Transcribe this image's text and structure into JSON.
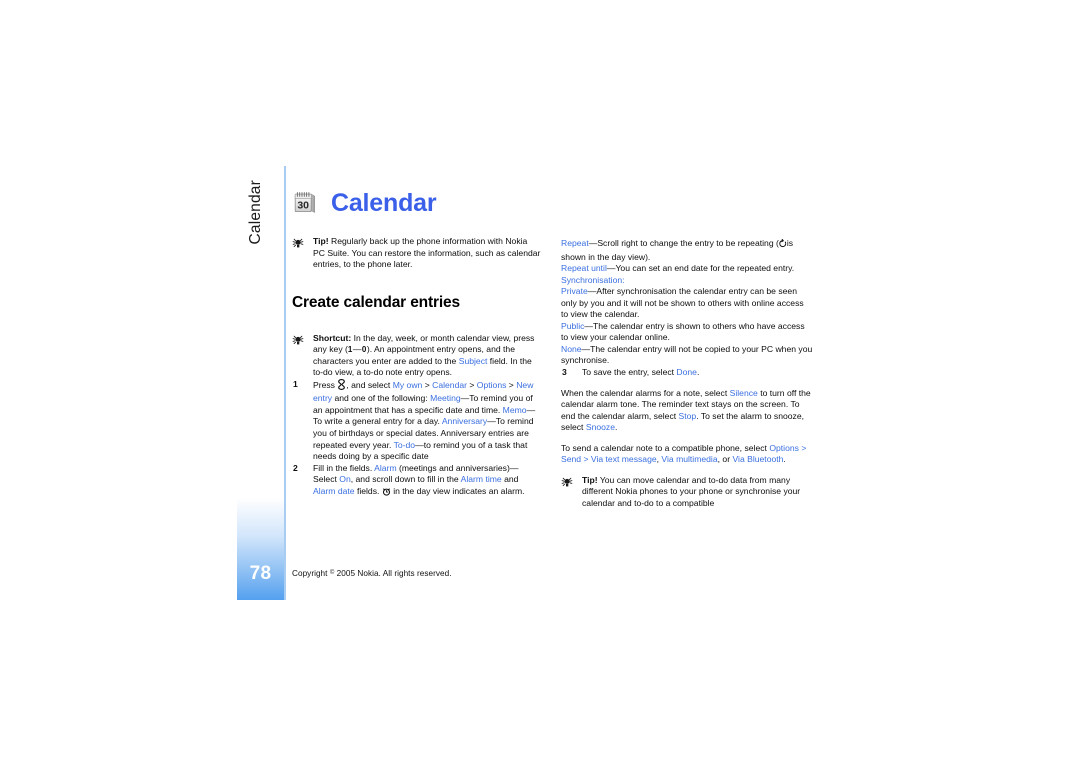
{
  "document": {
    "chapter_tab_label": "Calendar",
    "page_number": "78",
    "copyright": "Copyright  2005 Nokia. All rights reserved.",
    "copyright_symbol": "©",
    "title": "Calendar",
    "title_color": "#3a5fe8",
    "icon_name": "calendar-icon",
    "icon_day": "30"
  },
  "left_column": {
    "tip_top": {
      "label": "Tip!",
      "text": "Regularly back up the phone information with Nokia PC Suite. You can restore the information, such as calendar entries, to the phone later."
    },
    "section_heading": "Create calendar entries",
    "shortcut": {
      "label": "Shortcut:",
      "part1": "In the day, week, or month calendar view, press any key (",
      "key_from": "1",
      "key_dash": "—",
      "key_to": "0",
      "part2": "). An appointment entry opens, and the characters you enter are added to the ",
      "link_subject": "Subject",
      "part3": " field. In the to-do view, a to-do note entry opens."
    },
    "step1": {
      "num": "1",
      "intro": "Press",
      "menu_key_icon": "nokia-menu-key-icon",
      "after_key": ", and select ",
      "nav_my_own": "My own",
      "nav_sep1": " > ",
      "nav_calendar": "Calendar",
      "nav_sep2": " > ",
      "nav_options": "Options",
      "nav_sep3": " > ",
      "nav_new_entry": "New entry",
      "tail": " and one of the following:",
      "items": [
        {
          "term": "Meeting",
          "dash": "—",
          "desc": "To remind you of an appointment that has a specific date and time."
        },
        {
          "term": "Memo",
          "dash": "—",
          "desc": "To write a general entry for a day."
        },
        {
          "term": "Anniversary",
          "dash": "—",
          "desc": "To remind you of birthdays or special dates. Anniversary entries are repeated every year."
        },
        {
          "term": "To-do",
          "dash": "—",
          "desc": "to remind you of a task that needs doing by a specific date"
        }
      ]
    },
    "step2": {
      "num": "2",
      "text": "Fill in the fields.",
      "alarm_term": "Alarm",
      "alarm_mid": " (meetings and anniversaries)—Select ",
      "alarm_on": "On",
      "alarm_after": ", and scroll down to fill in the ",
      "alarm_time": "Alarm time",
      "alarm_and": " and ",
      "alarm_date": "Alarm date",
      "alarm_tail1": " fields.",
      "alarm_icon": "alarm-clock-icon",
      "alarm_tail2": "in the day view indicates an alarm."
    }
  },
  "right_column": {
    "repeat": {
      "term": "Repeat",
      "dash": "—",
      "part1": "Scroll right to change the entry to be repeating (",
      "repeat_icon": "repeat-circular-arrow-icon",
      "part2": "is shown in the day view)."
    },
    "repeat_until": {
      "term": "Repeat until",
      "dash": "—",
      "desc": "You can set an end date for the repeated entry."
    },
    "synchronisation": {
      "term": "Synchronisation",
      "colon": ":"
    },
    "private": {
      "term": "Private",
      "dash": "—",
      "desc": "After synchronisation the calendar entry can be seen only by you and it will not be shown to others with online access to view the calendar."
    },
    "public": {
      "term": "Public",
      "dash": "—",
      "desc": "The calendar entry is shown to others who have access to view your calendar online."
    },
    "none": {
      "term": "None",
      "dash": "—",
      "desc": "The calendar entry will not be copied to your PC when you synchronise."
    },
    "step3": {
      "num": "3",
      "part1": "To save the entry, select ",
      "link_done": "Done",
      "part2": "."
    },
    "alarm_para": {
      "part1": "When the calendar alarms for a note, select ",
      "link_silence": "Silence",
      "part2": " to turn off the calendar alarm tone. The reminder text stays on the screen. To end the calendar alarm, select ",
      "link_stop": "Stop",
      "part3": ". To set the alarm to snooze, select ",
      "link_snooze": "Snooze",
      "part4": "."
    },
    "send_para": {
      "part1": "To send a calendar note to a compatible phone, select ",
      "link_options": "Options",
      "sep1": " > ",
      "link_send": "Send",
      "sep2": " > ",
      "link_via_text": "Via text message",
      "sep3": ", ",
      "link_via_mms": "Via multimedia",
      "sep4": ", or ",
      "link_via_bt": "Via Bluetooth",
      "part2": "."
    },
    "tip_bottom": {
      "label": "Tip!",
      "text": "You can move calendar and to-do data from many different Nokia phones to your phone or synchronise your calendar and to-do to a compatible"
    }
  },
  "colors": {
    "link_blue": "#3a6fe0",
    "title_blue": "#3a5fe8",
    "rule_blue": "#a9cdf2",
    "tab_gradient_end": "#54a0ef"
  }
}
